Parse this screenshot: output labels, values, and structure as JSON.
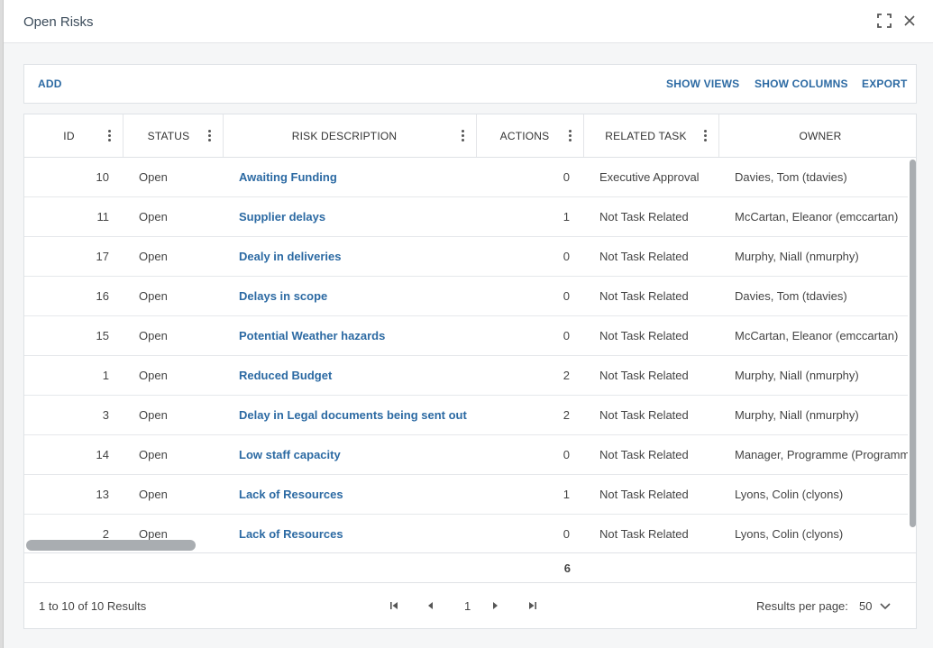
{
  "dialog": {
    "title": "Open Risks",
    "icons": {
      "maximize": "maximize-icon",
      "close": "close-icon"
    }
  },
  "toolbar": {
    "add_label": "ADD",
    "show_views_label": "SHOW VIEWS",
    "show_columns_label": "SHOW COLUMNS",
    "export_label": "EXPORT"
  },
  "table": {
    "columns": {
      "id": "ID",
      "status": "STATUS",
      "risk_description": "RISK DESCRIPTION",
      "actions": "ACTIONS",
      "related_task": "RELATED TASK",
      "owner": "OWNER"
    },
    "rows": [
      {
        "id": "10",
        "status": "Open",
        "description": "Awaiting Funding",
        "actions": "0",
        "related_task": "Executive Approval",
        "owner": "Davies, Tom (tdavies)"
      },
      {
        "id": "11",
        "status": "Open",
        "description": "Supplier delays",
        "actions": "1",
        "related_task": "Not Task Related",
        "owner": "McCartan, Eleanor (emccartan)"
      },
      {
        "id": "17",
        "status": "Open",
        "description": "Dealy in deliveries",
        "actions": "0",
        "related_task": "Not Task Related",
        "owner": "Murphy, Niall (nmurphy)"
      },
      {
        "id": "16",
        "status": "Open",
        "description": "Delays in scope",
        "actions": "0",
        "related_task": "Not Task Related",
        "owner": "Davies, Tom (tdavies)"
      },
      {
        "id": "15",
        "status": "Open",
        "description": "Potential Weather hazards",
        "actions": "0",
        "related_task": "Not Task Related",
        "owner": "McCartan, Eleanor (emccartan)"
      },
      {
        "id": "1",
        "status": "Open",
        "description": "Reduced Budget",
        "actions": "2",
        "related_task": "Not Task Related",
        "owner": "Murphy, Niall (nmurphy)"
      },
      {
        "id": "3",
        "status": "Open",
        "description": "Delay in Legal documents being sent out",
        "actions": "2",
        "related_task": "Not Task Related",
        "owner": "Murphy, Niall (nmurphy)"
      },
      {
        "id": "14",
        "status": "Open",
        "description": "Low staff capacity",
        "actions": "0",
        "related_task": "Not Task Related",
        "owner": "Manager, Programme (Programme"
      },
      {
        "id": "13",
        "status": "Open",
        "description": "Lack of Resources",
        "actions": "1",
        "related_task": "Not Task Related",
        "owner": "Lyons, Colin (clyons)"
      },
      {
        "id": "2",
        "status": "Open",
        "description": "Lack of Resources",
        "actions": "0",
        "related_task": "Not Task Related",
        "owner": "Lyons, Colin (clyons)"
      }
    ],
    "actions_total": "6"
  },
  "pager": {
    "summary": "1 to 10 of 10 Results",
    "current_page": "1",
    "per_page_label": "Results per page:",
    "per_page_value": "50"
  },
  "colors": {
    "link": "#2c6aa3",
    "scrollbar": "#a9adb1"
  }
}
